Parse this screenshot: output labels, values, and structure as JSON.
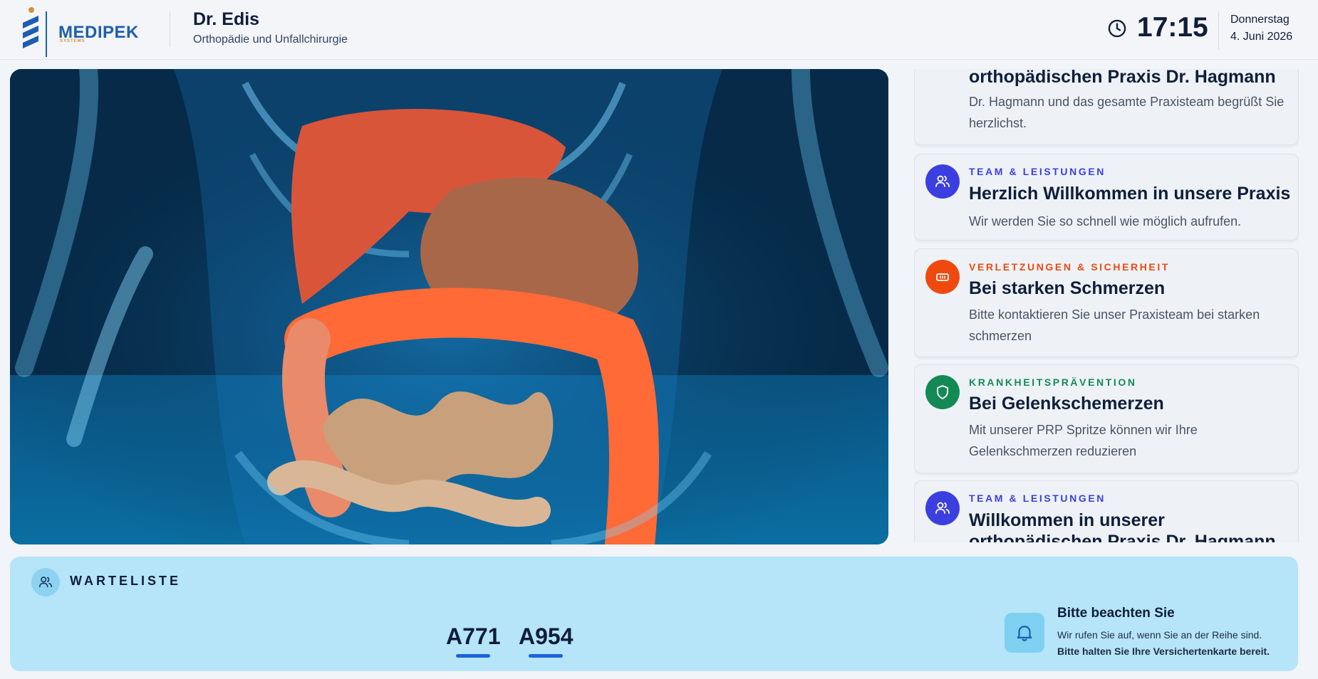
{
  "header": {
    "logo_name": "MEDIPEK",
    "logo_sub": "SYSTEMS",
    "doctor_name": "Dr. Edis",
    "specialty": "Orthopädie und Unfallchirurgie",
    "time": "17:15",
    "weekday": "Donnerstag",
    "date": "4. Juni 2026",
    "clock_icon": "clock-icon"
  },
  "colors": {
    "brand": "#1d5fae",
    "brand_gold": "#c8953a",
    "team": "#3b3fe0",
    "injury": "#f0490f",
    "prevention": "#138a55",
    "waitlist_bg": "#b6e4f8",
    "ticket_underline": "#1a62e0"
  },
  "news": {
    "items": [
      {
        "title": "orthopädischen Praxis Dr. Hagmann",
        "text": "Dr. Hagmann und das gesamte Praxisteam begrüßt Sie herzlichst."
      },
      {
        "category": "TEAM & LEISTUNGEN",
        "icon": "users-icon",
        "title": "Herzlich Willkommen in unsere Praxis",
        "text": "Wir werden Sie so schnell wie möglich aufrufen."
      },
      {
        "category": "VERLETZUNGEN & SICHERHEIT",
        "icon": "bandage-icon",
        "title": "Bei starken Schmerzen",
        "text": "Bitte kontaktieren Sie unser Praxisteam bei starken schmerzen"
      },
      {
        "category": "KRANKHEITSPRÄVENTION",
        "icon": "shield-icon",
        "title": "Bei Gelenkschemerzen",
        "text": "Mit unserer PRP Spritze können wir Ihre Gelenkschmerzen reduzieren"
      },
      {
        "category": "TEAM & LEISTUNGEN",
        "icon": "users-icon",
        "title": "Willkommen in unserer",
        "title2": "orthopädischen Praxis Dr. Hagmann"
      }
    ]
  },
  "waitlist": {
    "title": "WARTELISTE",
    "icon": "users-icon",
    "tickets": [
      "A771",
      "A954"
    ],
    "notice_icon": "bell-icon",
    "notice_title": "Bitte beachten Sie",
    "notice_line1": "Wir rufen Sie auf, wenn Sie an der Reihe sind.",
    "notice_line2": "Bitte halten Sie Ihre Versichertenkarte bereit."
  }
}
